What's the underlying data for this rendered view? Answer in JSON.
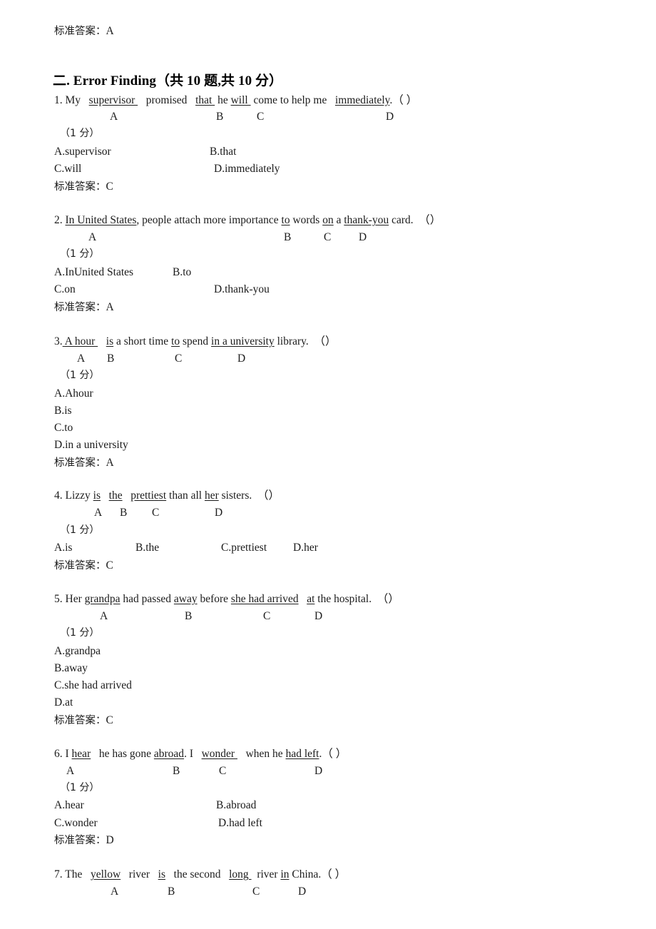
{
  "document": {
    "top_answer_line": {
      "label": "标准答案：",
      "value": "A"
    },
    "section": {
      "heading": "二. Error Finding（共 10 题,共 10 分）"
    },
    "score_label": "（1 分）",
    "answer_label": "标准答案：",
    "questions": [
      {
        "number": "1.",
        "stem_parts": [
          {
            "text": "My",
            "underline": false
          },
          {
            "text": "supervisor ",
            "underline": true
          },
          {
            "text": "promised",
            "underline": false
          },
          {
            "text": "that ",
            "underline": true
          },
          {
            "text": "he ",
            "underline": false
          },
          {
            "text": "will ",
            "underline": true
          },
          {
            "text": "come to help me",
            "underline": false
          },
          {
            "text": "immediately",
            "underline": true
          },
          {
            "text": ".",
            "underline": false
          }
        ],
        "stem_text": "1. My   supervisor    promised   that   he will   come to help me   immediately. （ ）",
        "blank_paren": "（ ）",
        "markers": [
          "A",
          "B",
          "C",
          "D"
        ],
        "score": "（1 分）",
        "options": [
          {
            "key": "A",
            "label": "A.supervisor"
          },
          {
            "key": "B",
            "label": "B.that"
          },
          {
            "key": "C",
            "label": "C.will"
          },
          {
            "key": "D",
            "label": "D.immediately"
          }
        ],
        "option_layout": "two-column",
        "answer": "C"
      },
      {
        "number": "2.",
        "stem_text": "2. In United States, people attach more importance to words on a thank-you card.  （）",
        "blank_paren": "（）",
        "markers": [
          "A",
          "B",
          "C",
          "D"
        ],
        "score": "（1 分）",
        "options": [
          {
            "key": "A",
            "label": "A.InUnited States"
          },
          {
            "key": "B",
            "label": "B.to"
          },
          {
            "key": "C",
            "label": "C.on"
          },
          {
            "key": "D",
            "label": "D.thank-you"
          }
        ],
        "option_layout": "two-column",
        "answer": "A"
      },
      {
        "number": "3.",
        "stem_text": "3. A hour   is a short time to spend in a university library.  （）",
        "blank_paren": "（）",
        "markers": [
          "A",
          "B",
          "C",
          "D"
        ],
        "score": "（1 分）",
        "options": [
          {
            "key": "A",
            "label": "A.Ahour"
          },
          {
            "key": "B",
            "label": "B.is"
          },
          {
            "key": "C",
            "label": "C.to"
          },
          {
            "key": "D",
            "label": "D.in a university"
          }
        ],
        "option_layout": "stacked",
        "answer": "A"
      },
      {
        "number": "4.",
        "stem_text": "4. Lizzy is   the   prettiest than all her sisters.  （）",
        "blank_paren": "（）",
        "markers": [
          "A",
          "B",
          "C",
          "D"
        ],
        "score": "（1 分）",
        "options": [
          {
            "key": "A",
            "label": "A.is"
          },
          {
            "key": "B",
            "label": "B.the"
          },
          {
            "key": "C",
            "label": "C.prettiest"
          },
          {
            "key": "D",
            "label": "D.her"
          }
        ],
        "option_layout": "single-row",
        "answer": "C"
      },
      {
        "number": "5.",
        "stem_text": "5. Her grandpa had passed away before she had arrived   at the hospital.  （）",
        "blank_paren": "（）",
        "markers": [
          "A",
          "B",
          "C",
          "D"
        ],
        "score": "（1 分）",
        "options": [
          {
            "key": "A",
            "label": "A.grandpa"
          },
          {
            "key": "B",
            "label": "B.away"
          },
          {
            "key": "C",
            "label": "C.she had arrived"
          },
          {
            "key": "D",
            "label": "D.at"
          }
        ],
        "option_layout": "stacked",
        "answer": "C"
      },
      {
        "number": "6.",
        "stem_text": "6. I hear   he has gone abroad. I   wonder    when he had left. （ ）",
        "blank_paren": "（ ）",
        "markers": [
          "A",
          "B",
          "C",
          "D"
        ],
        "score": "（1 分）",
        "options": [
          {
            "key": "A",
            "label": "A.hear"
          },
          {
            "key": "B",
            "label": "B.abroad"
          },
          {
            "key": "C",
            "label": "C.wonder"
          },
          {
            "key": "D",
            "label": "D.had left"
          }
        ],
        "option_layout": "two-column",
        "answer": "D"
      },
      {
        "number": "7.",
        "stem_text": "7. The   yellow   river   is   the second   long   river in China. （ ）",
        "blank_paren": "（ ）",
        "markers": [
          "A",
          "B",
          "C",
          "D"
        ],
        "truncated": true
      }
    ]
  },
  "q1": {
    "num": "1.",
    "w1": "My",
    "w2": "supervisor ",
    "w3": "promised",
    "w4": "that ",
    "w5": "he ",
    "w6": "will ",
    "w7": "come to help me",
    "w8": "immediately",
    "w9": ".",
    "paren": "（ ）",
    "mA": "A",
    "mB": "B",
    "mC": "C",
    "mD": "D",
    "score": "（1 分）",
    "oA": "A.supervisor",
    "oB": "B.that",
    "oC": "C.will",
    "oD": "D.immediately",
    "ansLabel": "标准答案：",
    "ans": "C"
  },
  "q2": {
    "num": "2.",
    "w1": "In United States",
    "w2": ", people attach more importance ",
    "w3": "to",
    "w4": " words ",
    "w5": "on",
    "w6": " a ",
    "w7": "thank-you",
    "w8": " card.",
    "paren": "（）",
    "mA": "A",
    "mB": "B",
    "mC": "C",
    "mD": "D",
    "score": "（1 分）",
    "oA": "A.InUnited States",
    "oB": "B.to",
    "oC": "C.on",
    "oD": "D.thank-you",
    "ansLabel": "标准答案：",
    "ans": "A"
  },
  "q3": {
    "num": "3.",
    "w1": " A hour ",
    "w2": "  ",
    "w3": "is",
    "w4": " a short time ",
    "w5": "to",
    "w6": " spend ",
    "w7": "in a university",
    "w8": " library.",
    "paren": "（）",
    "mA": "A",
    "mB": "B",
    "mC": "C",
    "mD": "D",
    "score": "（1 分）",
    "oA": "A.Ahour",
    "oB": "B.is",
    "oC": "C.to",
    "oD": "D.in a university",
    "ansLabel": "标准答案：",
    "ans": "A"
  },
  "q4": {
    "num": "4.",
    "w1": "Lizzy ",
    "w2": "is",
    "w3": "   ",
    "w4": "the",
    "w5": "   ",
    "w6": "prettiest",
    "w7": " than all ",
    "w8": "her",
    "w9": " sisters.",
    "paren": "（）",
    "mA": "A",
    "mB": "B",
    "mC": "C",
    "mD": "D",
    "score": "（1 分）",
    "oA": "A.is",
    "oB": "B.the",
    "oC": "C.prettiest",
    "oD": "D.her",
    "ansLabel": "标准答案：",
    "ans": "C"
  },
  "q5": {
    "num": "5.",
    "w1": "Her ",
    "w2": "grandpa",
    "w3": " had passed ",
    "w4": "away",
    "w5": " before ",
    "w6": "she had arrived",
    "w7": "   ",
    "w8": "at",
    "w9": " the hospital.",
    "paren": "（）",
    "mA": "A",
    "mB": "B",
    "mC": "C",
    "mD": "D",
    "score": "（1 分）",
    "oA": "A.grandpa",
    "oB": "B.away",
    "oC": "C.she had arrived",
    "oD": "D.at",
    "ansLabel": "标准答案：",
    "ans": "C"
  },
  "q6": {
    "num": "6.",
    "w1": "I ",
    "w2": "hear",
    "w3": "   he has gone ",
    "w4": "abroad",
    "w5": ". I   ",
    "w6": "wonder ",
    "w7": "   when he ",
    "w8": "had left",
    "w9": ".",
    "paren": "（ ）",
    "mA": "A",
    "mB": "B",
    "mC": "C",
    "mD": "D",
    "score": "（1 分）",
    "oA": "A.hear",
    "oB": "B.abroad",
    "oC": "C.wonder",
    "oD": "D.had left",
    "ansLabel": "标准答案：",
    "ans": "D"
  },
  "q7": {
    "num": "7.",
    "w1": "The   ",
    "w2": "yellow",
    "w3": "   river   ",
    "w4": "is",
    "w5": "   the second   ",
    "w6": "long ",
    "w7": "  river ",
    "w8": "in",
    "w9": " China.",
    "paren": "（ ）",
    "mA": "A",
    "mB": "B",
    "mC": "C",
    "mD": "D"
  },
  "top": {
    "ansLabel": "标准答案：",
    "ans": "A"
  },
  "heading": {
    "text": "二. Error Finding（共 10 题,共 10 分）"
  }
}
